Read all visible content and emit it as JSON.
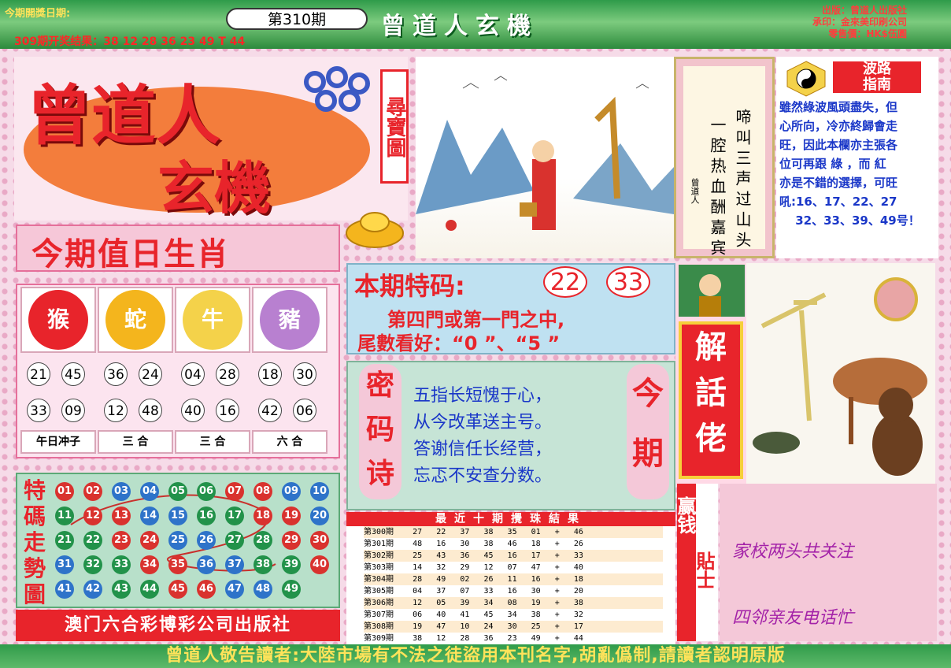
{
  "header": {
    "draw_date_label": "今期開獎日期:",
    "issue": "第310期",
    "title": "曾道人玄機",
    "previous_result": "309期开奖结果：38 12 28 36 23 49 T 44",
    "publisher_lines": [
      "出版：曾道人出版社",
      "承印：金來美印刷公司",
      "零售價：HK$伍圓"
    ]
  },
  "logo": {
    "main": "曾道人",
    "sub": "玄機",
    "badge": "尋寶圖"
  },
  "poem": {
    "col_right": "啼叫三声过山头",
    "col_left": "一腔热血酬嘉宾",
    "signature": "曾道人"
  },
  "guide": {
    "title_top": "波路",
    "title_bottom": "指南",
    "lines": [
      "雖然綠波風頭盡失，但",
      "心所向，冷亦終歸會走",
      "旺，因此本欄亦主張各",
      "位可再跟 綠 ，而 紅",
      "亦是不錯的選擇，可旺",
      "吼:16、17、22、27",
      "　 32、33、39、49号！"
    ]
  },
  "zodiac": {
    "title": "今期值日生肖",
    "cells": [
      {
        "animal": "猴",
        "numbers": [
          "21",
          "45",
          "33",
          "09"
        ],
        "label": "午日冲子"
      },
      {
        "animal": "蛇",
        "numbers": [
          "36",
          "24",
          "12",
          "48"
        ],
        "label": "三 合"
      },
      {
        "animal": "牛",
        "numbers": [
          "04",
          "28",
          "40",
          "16"
        ],
        "label": "三 合"
      },
      {
        "animal": "豬",
        "numbers": [
          "18",
          "30",
          "42",
          "06"
        ],
        "label": "六 合"
      }
    ]
  },
  "trend": {
    "label": "特碼走勢圖",
    "rows": [
      [
        "01",
        "02",
        "03",
        "04",
        "05",
        "06",
        "07",
        "08",
        "09",
        "10"
      ],
      [
        "11",
        "12",
        "13",
        "14",
        "15",
        "16",
        "17",
        "18",
        "19",
        "20"
      ],
      [
        "21",
        "22",
        "23",
        "24",
        "25",
        "26",
        "27",
        "28",
        "29",
        "30"
      ],
      [
        "31",
        "32",
        "33",
        "34",
        "35",
        "36",
        "37",
        "38",
        "39",
        "40"
      ],
      [
        "41",
        "42",
        "43",
        "44",
        "45",
        "46",
        "47",
        "48",
        "49"
      ]
    ],
    "colors": {
      "red": "#d9322e",
      "blue": "#2e73c9",
      "green": "#22924a"
    }
  },
  "publisher_bar": "澳门六合彩博彩公司出版社",
  "special": {
    "title": "本期特码:",
    "numbers": [
      "22",
      "33"
    ],
    "line1": "第四門或第一門之中,",
    "line2": "尾數看好：“0 ”、“5 ”"
  },
  "code_poem": {
    "left": "密码诗",
    "right": "今期",
    "lines": [
      "五指长短愧于心，",
      "从今改革送主号。",
      "答谢信任长经营，",
      "忘忑不安查分数。"
    ]
  },
  "history": {
    "title": "最近十期攪珠結果",
    "rows": [
      "第300期    27   22   37   38   35   01   +   46",
      "第301期    48   16   30   38   46   18   +   26",
      "第302期    25   43   36   45   16   17   +   33",
      "第303期    14   32   29   12   07   47   +   40",
      "第304期    28   49   02   26   11   16   +   18",
      "第305期    04   37   07   33   16   30   +   20",
      "第306期    12   05   39   34   08   19   +   38",
      "第307期    06   40   41   45   34   38   +   32",
      "第308期    19   47   10   24   30   25   +   17",
      "第309期    38   12   28   36   23   49   +   44"
    ]
  },
  "jiehua": "解話佬",
  "tips": {
    "label1": "赢钱",
    "label2": "貼士",
    "line1": "家校两头共关注",
    "line2": "四邻亲友电话忙"
  },
  "footer": "曾道人敬告讀者:大陸市場有不法之徒盜用本刊名字,胡亂僞制,請讀者認明原版"
}
